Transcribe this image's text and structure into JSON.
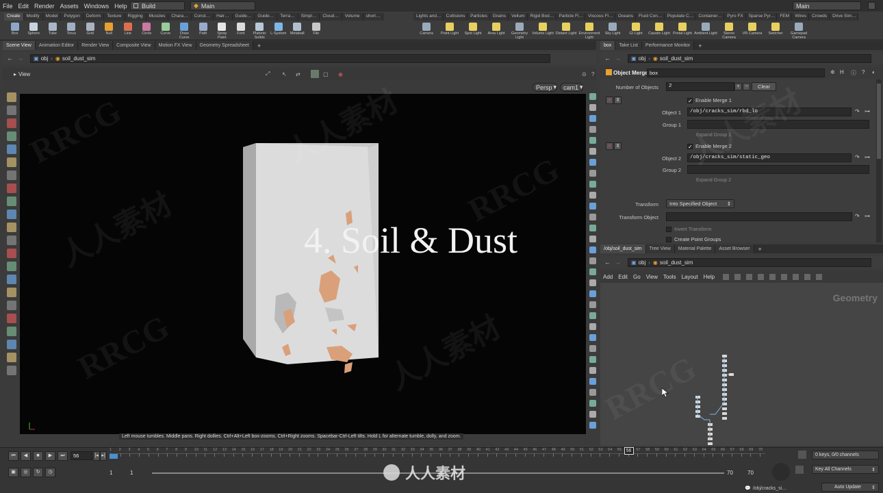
{
  "menubar": {
    "items": [
      "File",
      "Edit",
      "Render",
      "Assets",
      "Windows",
      "Help"
    ],
    "desktop": "Build",
    "context": "Main",
    "right_context": "Main"
  },
  "shelf": {
    "tabs_left": [
      "Create",
      "Modify",
      "Model",
      "Polygon",
      "Deform",
      "Texture",
      "Rigging",
      "Muscles",
      "Chara…",
      "Const…",
      "Hair…",
      "Guide…",
      "Guide…",
      "Terra…",
      "Simpl…",
      "Cloud…",
      "Volume",
      "short…"
    ],
    "tabs_right": [
      "Lights and…",
      "Collisions",
      "Particles",
      "Grains",
      "Vellum",
      "Rigid Bod…",
      "Particle Fl…",
      "Viscous Fl…",
      "Oceans",
      "Fluid Con…",
      "Populate C…",
      "Container…",
      "Pyro FX",
      "Sparse Pyr…",
      "FEM",
      "Wires",
      "Crowds",
      "Drive Sim…"
    ],
    "tools_left": [
      "Box",
      "Sphere",
      "Tube",
      "Torus",
      "Grid",
      "Null",
      "Line",
      "Circle",
      "Curve",
      "Draw Curve",
      "Path",
      "Spray Paint",
      "Font",
      "Platonic Solids",
      "L-System",
      "Metaball",
      "File"
    ],
    "tools_right": [
      "Camera",
      "Point Light",
      "Spot Light",
      "Area Light",
      "Geometry Light",
      "Volume Light",
      "Distant Light",
      "Environment Light",
      "Sky Light",
      "GI Light",
      "Caustic Light",
      "Portal Light",
      "Ambient Light",
      "Stereo Camera",
      "VR Camera",
      "Switcher",
      "Gamepad Camera"
    ]
  },
  "left_pane": {
    "tabs": [
      "Scene View",
      "Animation Editor",
      "Render View",
      "Composite View",
      "Motion FX View",
      "Geometry Spreadsheet"
    ],
    "path_root": "obj",
    "path_node": "soil_dust_sim",
    "view_label": "View",
    "persp": "Persp",
    "cam": "cam1",
    "title_overlay": "4. Soil & Dust",
    "status": "Left mouse tumbles. Middle pans. Right dollies. Ctrl+Alt+Left box-zooms. Ctrl+Right zooms. Spacebar-Ctrl-Left tilts. Hold L for alternate tumble, dolly, and zoom."
  },
  "parm_pane": {
    "tabs": [
      "box",
      "Take List",
      "Performance Monitor"
    ],
    "path_root": "obj",
    "path_node": "soil_dust_sim",
    "node_type": "Object Merge",
    "node_name": "box",
    "num_objects_label": "Number of Objects",
    "num_objects": "2",
    "clear_label": "Clear",
    "enable1": "Enable Merge 1",
    "object1_label": "Object 1",
    "object1": "/obj/cracks_sim/rbd_lo",
    "group1_label": "Group 1",
    "expand1": "Expand Group 1",
    "enable2": "Enable Merge 2",
    "object2_label": "Object 2",
    "object2": "/obj/cracks_sim/static_geo",
    "group2_label": "Group 2",
    "expand2": "Expand Group 2",
    "transform_label": "Transform",
    "transform_value": "Into Specified Object",
    "transform_obj_label": "Transform Object",
    "invert": "Invert Transform",
    "create_groups": "Create Point Groups"
  },
  "network_pane": {
    "tabs": [
      "/obj/soil_dust_sim",
      "Tree View",
      "Material Palette",
      "Asset Browser"
    ],
    "path_root": "obj",
    "path_node": "soil_dust_sim",
    "menu": [
      "Add",
      "Edit",
      "Go",
      "View",
      "Tools",
      "Layout",
      "Help"
    ],
    "context_label": "Geometry"
  },
  "timeline": {
    "frame": "56",
    "ticks": [
      "1",
      "2",
      "3",
      "4",
      "5",
      "6",
      "7",
      "8",
      "9",
      "10",
      "11",
      "12",
      "13",
      "14",
      "15",
      "16",
      "17",
      "18",
      "19",
      "20",
      "21",
      "22",
      "23",
      "24",
      "25",
      "26",
      "27",
      "28",
      "29",
      "30",
      "31",
      "32",
      "33",
      "34",
      "35",
      "36",
      "37",
      "38",
      "39",
      "40",
      "41",
      "42",
      "43",
      "44",
      "45",
      "46",
      "47",
      "48",
      "49",
      "50",
      "51",
      "52",
      "53",
      "54",
      "55",
      "56",
      "57",
      "58",
      "59",
      "60",
      "61",
      "62",
      "63",
      "64",
      "65",
      "66",
      "67",
      "68",
      "69",
      "70"
    ],
    "current_fraction": 0.797,
    "start": "1",
    "start2": "1",
    "end": "70",
    "end2": "70",
    "keys": "0 keys, 0/0 channels",
    "key_all": "Key All Channels",
    "path": "/obj/cracks_si…",
    "auto_update": "Auto Update"
  },
  "watermarks": [
    "RRCG",
    "人人素材",
    "RRCG",
    "人人素材",
    "RRCG",
    "人人素材",
    "RRCG",
    "人人素材"
  ],
  "colors": {
    "accent": "#e8a030",
    "viewport_bg": "#050505",
    "box": "#d8d8d8",
    "chip": "#d9a07a"
  }
}
